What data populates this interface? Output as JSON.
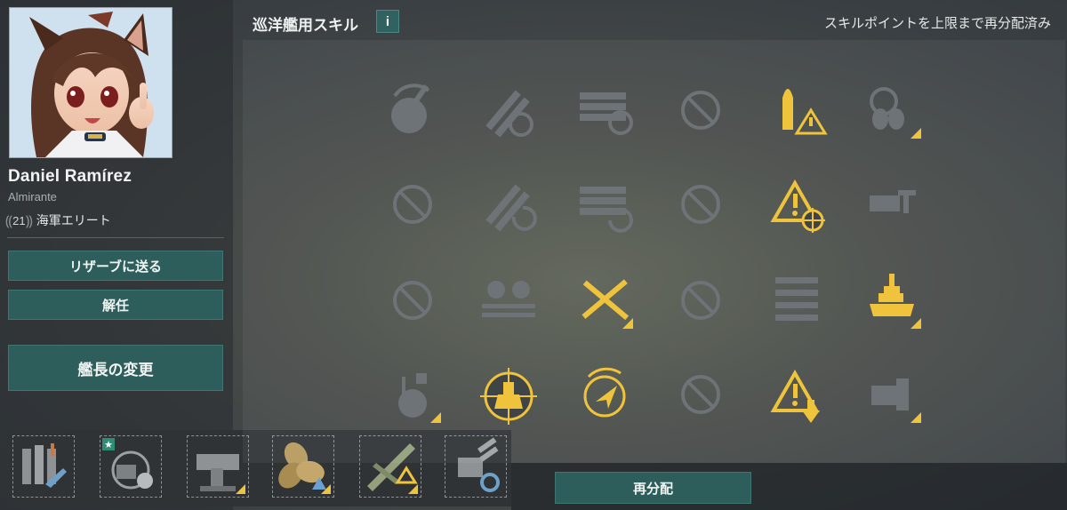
{
  "commander": {
    "name": "Daniel Ramírez",
    "rank": "Almirante",
    "level": "21",
    "title": "海軍エリート"
  },
  "actions": {
    "reserve": "リザーブに送る",
    "dismiss": "解任",
    "change_captain": "艦長の変更",
    "respec": "再分配"
  },
  "skills_header": {
    "title": "巡洋艦用スキル",
    "info": "i",
    "status": "スキルポイントを上限まで再分配済み"
  },
  "colors": {
    "accent_gold": "#f0c33c",
    "inactive_icon": "#6d7377",
    "button_teal": "#2e5e5c"
  },
  "skill_grid": [
    [
      "turret-rotation-icon",
      "reload-gauge-icon",
      "torpedo-reload-icon",
      "no-skill-icon",
      "ap-shell-warning-icon",
      "engine-boost-icon"
    ],
    [
      "no-skill-icon",
      "reload-cycle-icon",
      "torpedo-cycle-icon",
      "no-skill-icon",
      "warning-target-icon",
      "secondary-battery-icon"
    ],
    [
      "no-skill-icon",
      "depth-charge-icon",
      "crossed-guns-icon",
      "no-skill-icon",
      "torpedo-rack-icon",
      "superstructure-icon"
    ],
    [
      "radar-turret-icon",
      "ship-target-icon",
      "radar-arrow-icon",
      "no-skill-icon",
      "warning-down-icon",
      "armor-plate-icon"
    ]
  ],
  "skill_active": [
    [
      false,
      false,
      false,
      false,
      true,
      false
    ],
    [
      false,
      false,
      false,
      false,
      true,
      false
    ],
    [
      false,
      false,
      true,
      false,
      false,
      true
    ],
    [
      false,
      true,
      true,
      false,
      true,
      false
    ]
  ],
  "modules": [
    "main-battery-mod-icon",
    "aiming-system-mod-icon",
    "steering-gears-mod-icon",
    "propulsion-mod-icon",
    "aircraft-mod-icon",
    "turret-traverse-mod-icon"
  ]
}
